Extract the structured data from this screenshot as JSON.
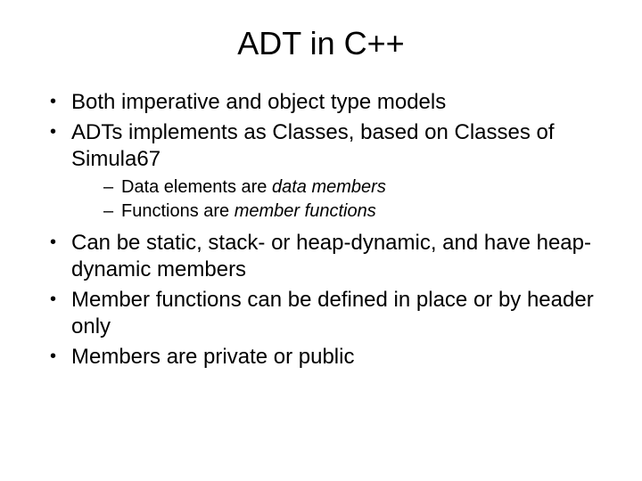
{
  "title": "ADT in C++",
  "bullets": [
    {
      "text": "Both imperative and object type models"
    },
    {
      "text": "ADTs implements as Classes, based on Classes of Simula67",
      "sub": [
        {
          "pre": "Data elements are ",
          "em": "data members"
        },
        {
          "pre": "Functions are ",
          "em": "member functions"
        }
      ]
    },
    {
      "text": "Can be static, stack- or heap-dynamic, and have heap-dynamic members"
    },
    {
      "text": "Member functions can be defined in place or by header only"
    },
    {
      "text": "Members are private or public"
    }
  ]
}
